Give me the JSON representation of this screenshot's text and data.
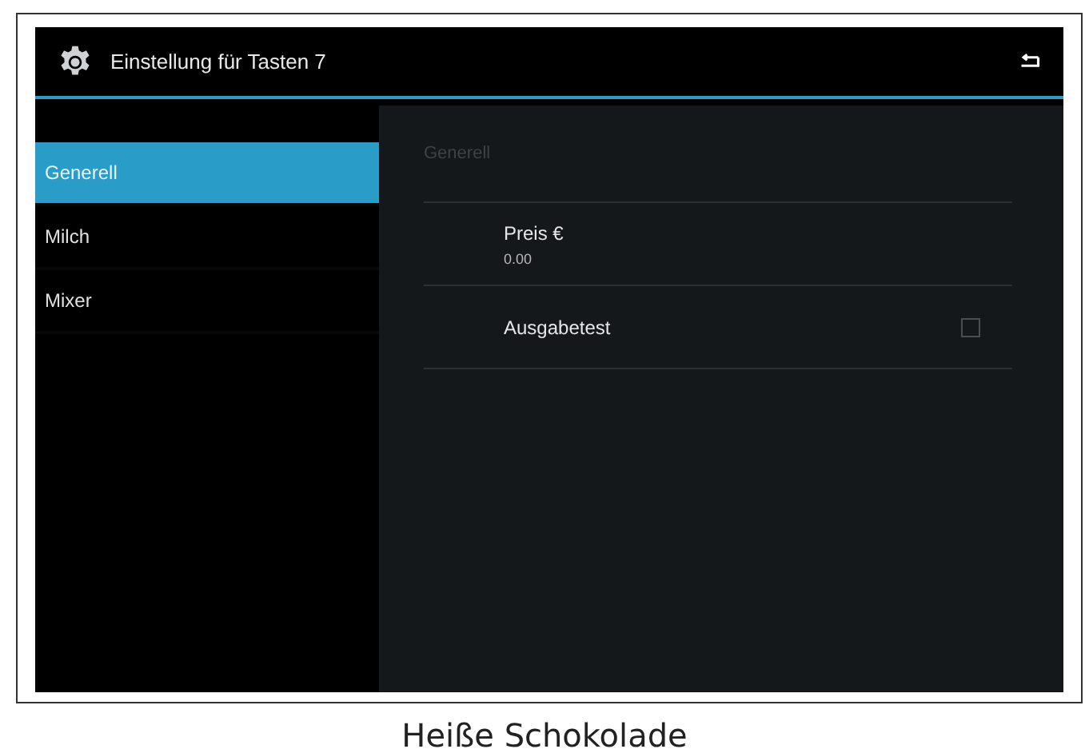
{
  "window": {
    "title": "Einstellung für Tasten 7"
  },
  "sidebar": {
    "items": [
      {
        "label": "Generell",
        "selected": true
      },
      {
        "label": "Milch",
        "selected": false
      },
      {
        "label": "Mixer",
        "selected": false
      }
    ]
  },
  "panel": {
    "heading": "Generell",
    "settings": [
      {
        "kind": "value",
        "label": "Preis €",
        "value": "0.00"
      },
      {
        "kind": "checkbox",
        "label": "Ausgabetest",
        "checked": false
      }
    ]
  },
  "caption": "Heiße Schokolade"
}
